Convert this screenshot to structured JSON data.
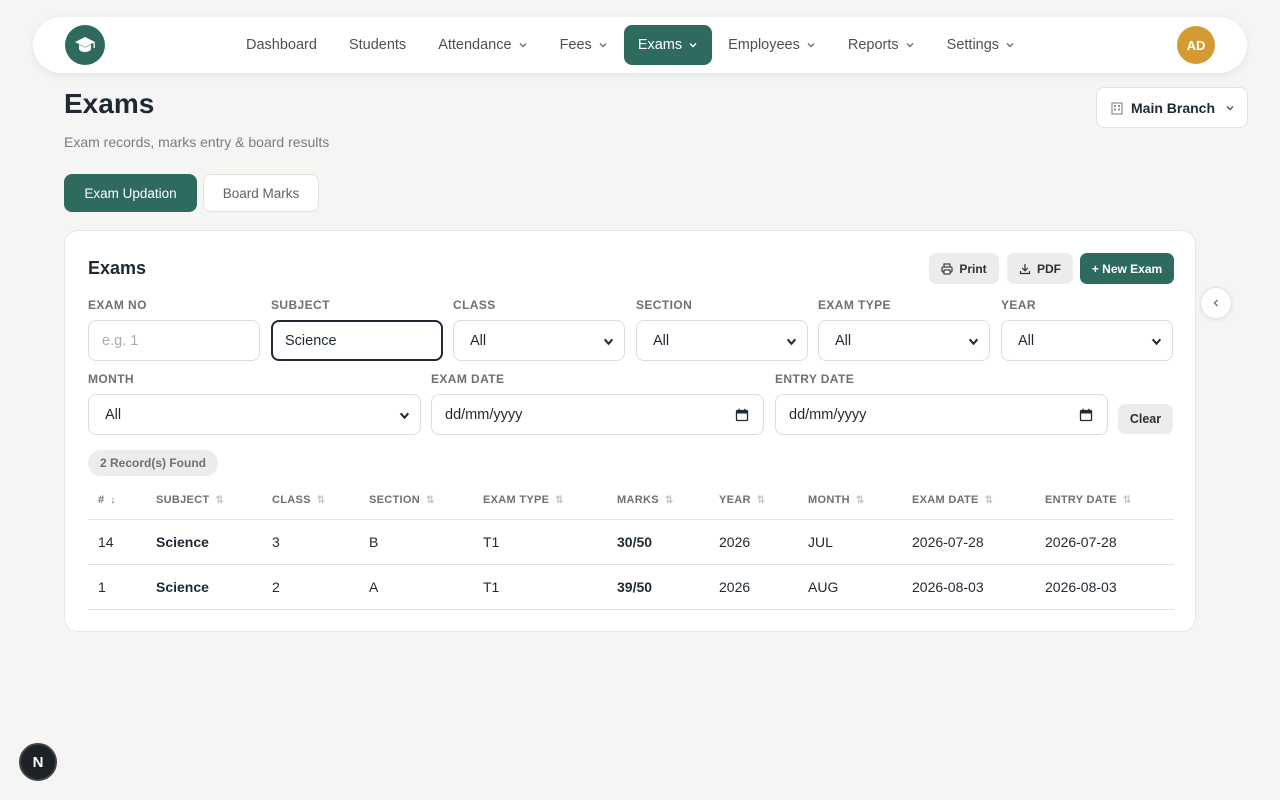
{
  "nav": {
    "items": [
      {
        "label": "Dashboard",
        "dropdown": false
      },
      {
        "label": "Students",
        "dropdown": false
      },
      {
        "label": "Attendance",
        "dropdown": true
      },
      {
        "label": "Fees",
        "dropdown": true
      },
      {
        "label": "Exams",
        "dropdown": true,
        "active": true
      },
      {
        "label": "Employees",
        "dropdown": true
      },
      {
        "label": "Reports",
        "dropdown": true
      },
      {
        "label": "Settings",
        "dropdown": true
      }
    ],
    "avatar_initials": "AD",
    "accent": "#2f6a5e",
    "avatar_color": "#d49a34"
  },
  "header": {
    "title": "Exams",
    "subtitle": "Exam records, marks entry & board results",
    "branch": "Main Branch"
  },
  "tabs": [
    "Exam Updation",
    "Board Marks"
  ],
  "card": {
    "title": "Exams",
    "print_label": "Print",
    "pdf_label": "PDF",
    "new_label": "+ New Exam",
    "clear_label": "Clear",
    "records_label": "2 Record(s) Found"
  },
  "filters": {
    "exam_no": {
      "label": "EXAM NO",
      "value": "",
      "placeholder": "e.g. 1"
    },
    "subject": {
      "label": "SUBJECT",
      "value": "Science"
    },
    "class": {
      "label": "CLASS",
      "value": "All"
    },
    "section": {
      "label": "SECTION",
      "value": "All"
    },
    "exam_type": {
      "label": "EXAM TYPE",
      "value": "All"
    },
    "year": {
      "label": "YEAR",
      "value": "All"
    },
    "month": {
      "label": "MONTH",
      "value": "All"
    },
    "exam_date": {
      "label": "EXAM DATE",
      "placeholder": "dd/mm/yyyy"
    },
    "entry_date": {
      "label": "ENTRY DATE",
      "placeholder": "dd/mm/yyyy"
    }
  },
  "table": {
    "columns": [
      "#",
      "SUBJECT",
      "CLASS",
      "SECTION",
      "EXAM TYPE",
      "MARKS",
      "YEAR",
      "MONTH",
      "EXAM DATE",
      "ENTRY DATE"
    ],
    "rows": [
      [
        "14",
        "Science",
        "3",
        "B",
        "T1",
        "30/50",
        "2026",
        "JUL",
        "2026-07-28",
        "2026-07-28"
      ],
      [
        "1",
        "Science",
        "2",
        "A",
        "T1",
        "39/50",
        "2026",
        "AUG",
        "2026-08-03",
        "2026-08-03"
      ]
    ]
  },
  "badge": "N"
}
